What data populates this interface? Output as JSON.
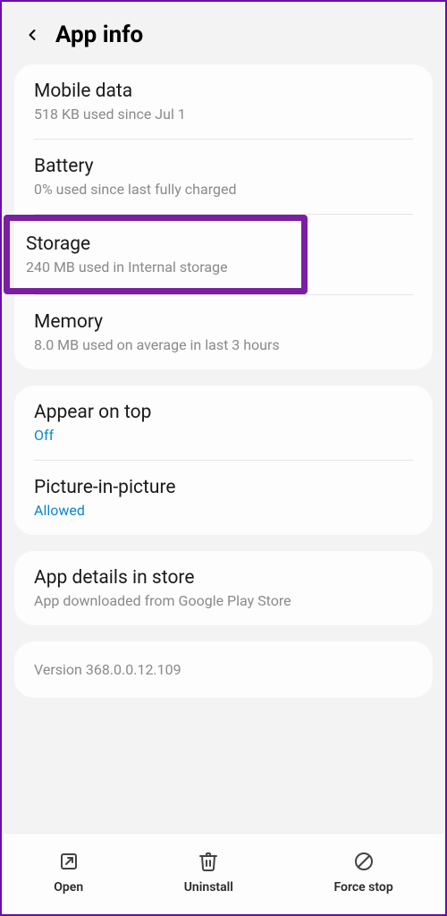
{
  "header": {
    "title": "App info"
  },
  "group1": {
    "mobile_data": {
      "title": "Mobile data",
      "sub": "518 KB used since Jul 1"
    },
    "battery": {
      "title": "Battery",
      "sub": "0% used since last fully charged"
    },
    "storage": {
      "title": "Storage",
      "sub": "240 MB used in Internal storage"
    },
    "memory": {
      "title": "Memory",
      "sub": "8.0 MB used on average in last 3 hours"
    }
  },
  "group2": {
    "appear": {
      "title": "Appear on top",
      "status": "Off"
    },
    "pip": {
      "title": "Picture-in-picture",
      "status": "Allowed"
    }
  },
  "group3": {
    "details": {
      "title": "App details in store",
      "sub": "App downloaded from Google Play Store"
    }
  },
  "version": "Version 368.0.0.12.109",
  "actions": {
    "open": "Open",
    "uninstall": "Uninstall",
    "force_stop": "Force stop"
  }
}
